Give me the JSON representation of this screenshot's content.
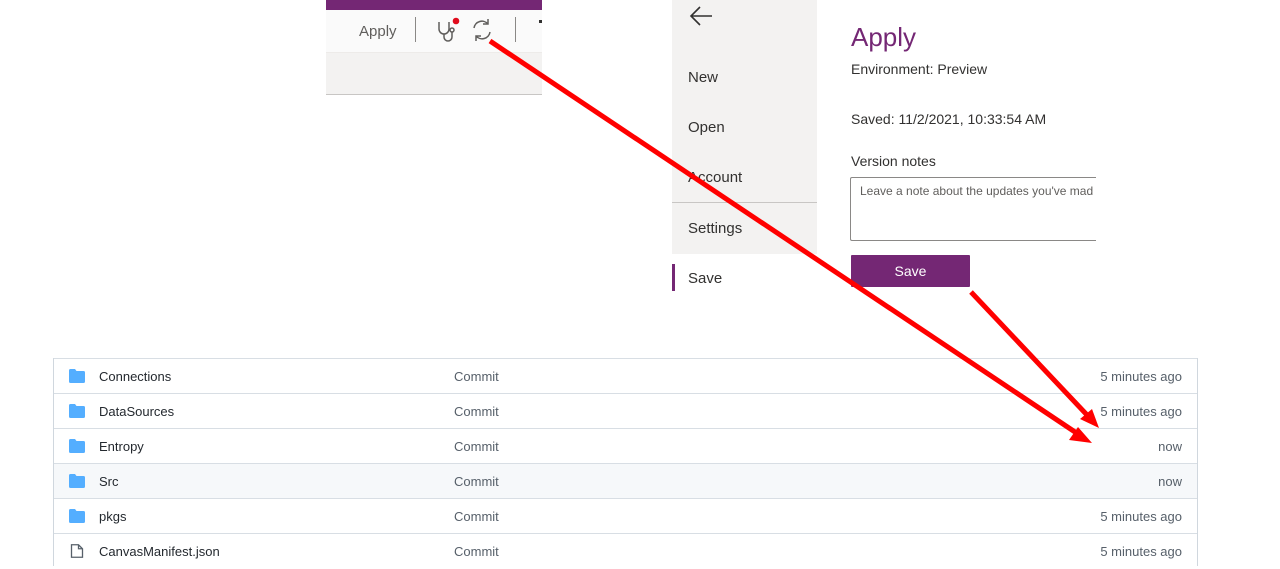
{
  "toolbar": {
    "apply_label": "Apply",
    "health_icon": "stethoscope-icon",
    "refresh_icon": "refresh-icon",
    "accent_color": "#742774",
    "notification_color": "#e00b1c"
  },
  "nav": {
    "back_icon": "back-arrow-icon",
    "items": [
      {
        "label": "New"
      },
      {
        "label": "Open"
      },
      {
        "label": "Account"
      },
      {
        "label": "Settings"
      },
      {
        "label": "Save"
      }
    ],
    "active": "Save"
  },
  "pane": {
    "title": "Apply",
    "environment": "Environment: Preview",
    "saved": "Saved: 11/2/2021, 10:33:54 AM",
    "notes_label": "Version notes",
    "notes_placeholder": "Leave a note about the updates you've mad",
    "save_label": "Save"
  },
  "repo": {
    "rows": [
      {
        "name": "Connections",
        "type": "folder",
        "message": "Commit",
        "age": "5 minutes ago"
      },
      {
        "name": "DataSources",
        "type": "folder",
        "message": "Commit",
        "age": "5 minutes ago"
      },
      {
        "name": "Entropy",
        "type": "folder",
        "message": "Commit",
        "age": "now"
      },
      {
        "name": "Src",
        "type": "folder",
        "message": "Commit",
        "age": "now"
      },
      {
        "name": "pkgs",
        "type": "folder",
        "message": "Commit",
        "age": "5 minutes ago"
      },
      {
        "name": "CanvasManifest.json",
        "type": "file",
        "message": "Commit",
        "age": "5 minutes ago"
      }
    ],
    "folder_color": "#54aeff"
  },
  "annotation": {
    "arrow_color": "#ff0000"
  }
}
